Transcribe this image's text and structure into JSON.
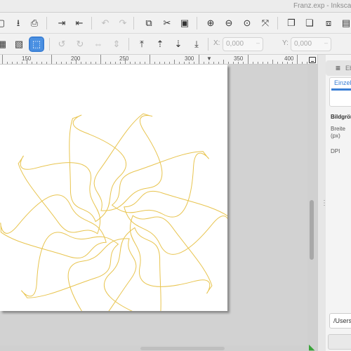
{
  "window": {
    "title": "Franz.exp - Inkscape"
  },
  "toolbar_top": {
    "icons": [
      "new-document-icon",
      "open-document-icon",
      "save-download-icon",
      "print-icon",
      "import-icon",
      "export-icon",
      "undo-icon",
      "redo-icon",
      "duplicate-icon",
      "cut-icon",
      "paste-icon",
      "zoom-selection-icon",
      "zoom-drawing-icon",
      "zoom-page-icon",
      "zoom-fit-icon",
      "group-icon",
      "ungroup-icon",
      "object-properties-icon"
    ]
  },
  "toolbar_select": {
    "x_label": "X:",
    "x_value": "0,000",
    "y_label": "Y:",
    "y_value": "0,000",
    "unit_symbol": "–"
  },
  "ruler": {
    "labels": [
      "150",
      "200",
      "250",
      "300",
      "350",
      "400"
    ]
  },
  "panel": {
    "tab_label": "Ebenen",
    "subtab_label": "Einzelbild",
    "section_heading": "Bildgröße",
    "width_label": "Breite",
    "width_unit": "(px)",
    "dpi_label": "DPI",
    "path_value": "/Users/",
    "collapse_grip": "⋮"
  },
  "canvas": {
    "stroke_color": "#e8c44e"
  }
}
